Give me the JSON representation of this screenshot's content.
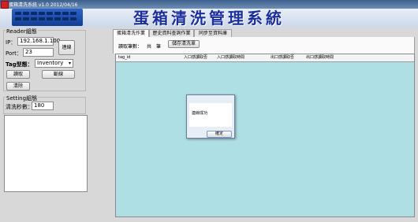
{
  "window": {
    "title": "蛋箱清洗系統 v1.0 2012/04/16"
  },
  "header": {
    "title": "蛋箱清洗管理系統"
  },
  "reader": {
    "legend": "Reader組態",
    "ip_label": "IP：",
    "ip_value": "192.168.1.100",
    "port_label": "Port：",
    "port_value": "23",
    "connect_label": "連線",
    "tag_label": "Tag型態：",
    "tag_value": "Inventory",
    "read_label": "讀取",
    "disconnect_label": "斷線",
    "clear_label": "清除"
  },
  "setting": {
    "legend": "Setting組態",
    "clean_label": "清洗秒數：",
    "clean_value": "180"
  },
  "tabs": [
    {
      "label": "蛋箱清洗作業",
      "active": true
    },
    {
      "label": "歷史資料查詢作業",
      "active": false
    },
    {
      "label": "同步至資料庫",
      "active": false
    }
  ],
  "tab_panel": {
    "count_label": "讀取筆數：",
    "count_unit": "共　筆",
    "save_label": "儲存清洗單"
  },
  "grid": {
    "columns": [
      "tag_id",
      "入口感讀取否",
      "入口感讀取時間",
      "出口感讀取否",
      "出口感讀取時間"
    ]
  },
  "dialog": {
    "message": "連線成功",
    "ok_label": "確定"
  },
  "colors": {
    "grid_background": "#aedfe4",
    "header_title": "#1a2e9c"
  }
}
